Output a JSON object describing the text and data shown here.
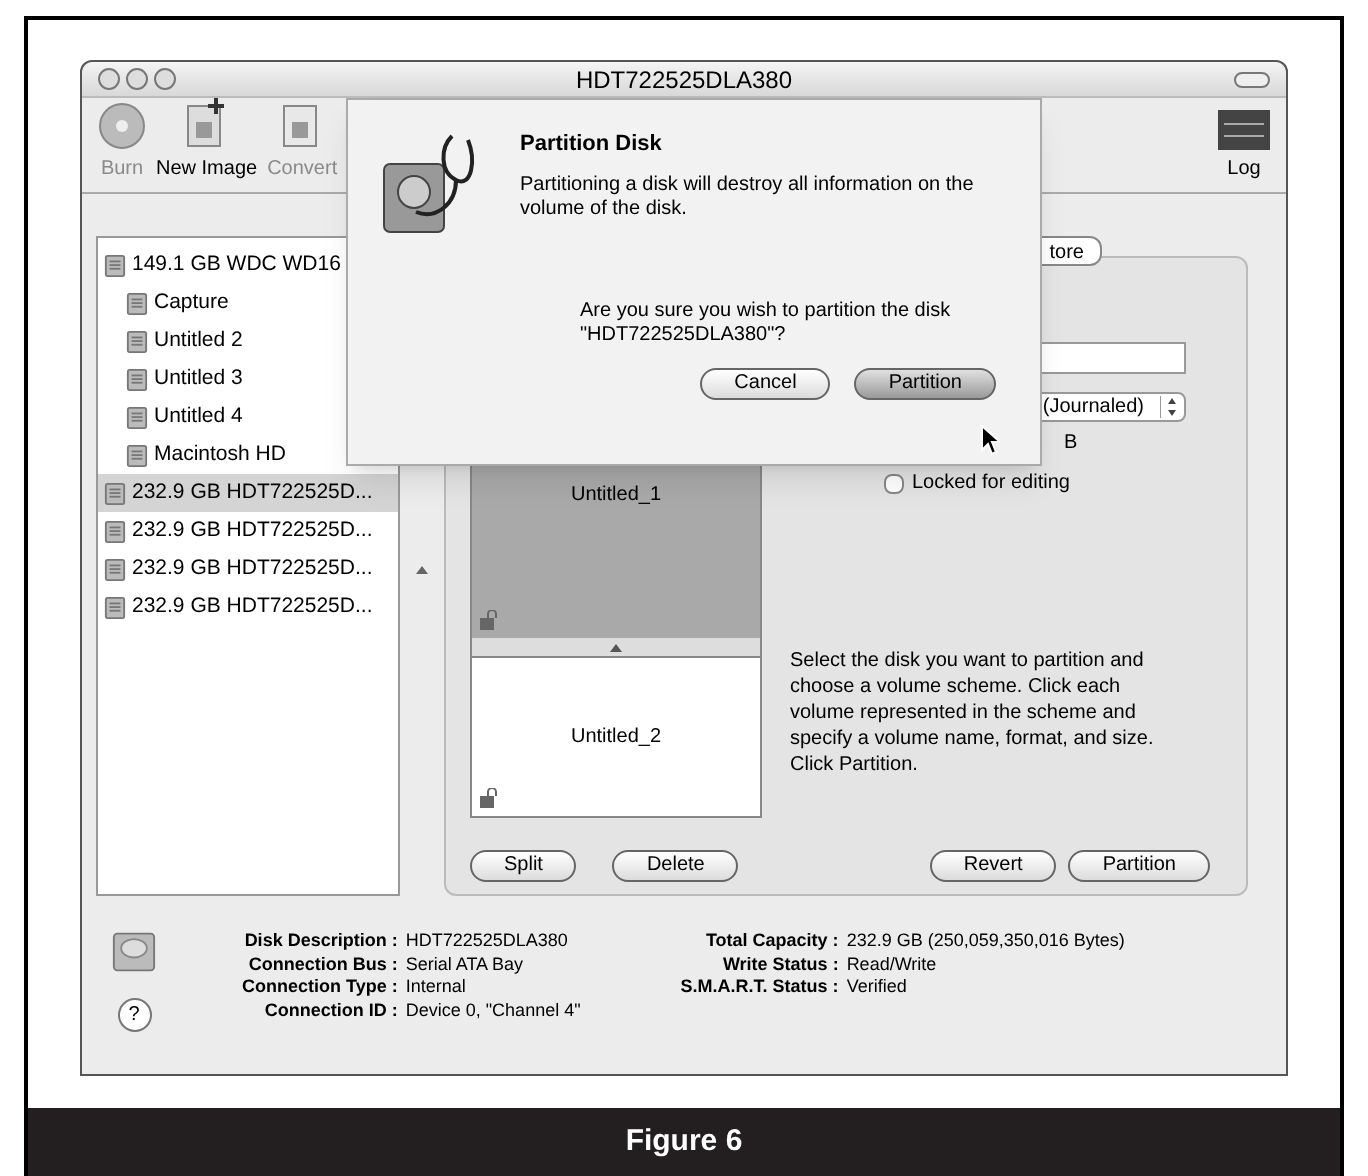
{
  "window": {
    "title": "HDT722525DLA380"
  },
  "toolbar": [
    {
      "label": "Burn",
      "disabled": true
    },
    {
      "label": "New Image",
      "disabled": false
    },
    {
      "label": "Convert",
      "disabled": true
    }
  ],
  "log": {
    "label": "Log"
  },
  "disks": [
    {
      "label": "149.1 GB WDC WD16",
      "selected": false,
      "children": [
        {
          "label": "Capture",
          "selected": false
        },
        {
          "label": "Untitled 2",
          "selected": false
        },
        {
          "label": "Untitled 3",
          "selected": false
        },
        {
          "label": "Untitled 4",
          "selected": false
        },
        {
          "label": "Macintosh HD",
          "selected": false
        }
      ]
    },
    {
      "label": "232.9 GB HDT722525D...",
      "selected": true
    },
    {
      "label": "232.9 GB HDT722525D...",
      "selected": false
    },
    {
      "label": "232.9 GB HDT722525D...",
      "selected": false
    },
    {
      "label": "232.9 GB HDT722525D...",
      "selected": false
    }
  ],
  "tabs": [
    {
      "label": "tore",
      "selected": false
    }
  ],
  "volumes": [
    {
      "name": "Untitled_1",
      "selected": true
    },
    {
      "name": "Untitled_2",
      "selected": false
    }
  ],
  "volume_info": {
    "format_value": "(Journaled)",
    "size_unit": "B",
    "locked": {
      "label": "Locked for editing",
      "checked": false
    }
  },
  "help_text": "Select the disk you want to partition and choose a volume scheme. Click each volume represented in the scheme and specify a volume name, format, and size. Click Partition.",
  "panel_buttons": {
    "left": [
      "Split",
      "Delete"
    ],
    "right": [
      "Revert",
      "Partition"
    ]
  },
  "info": {
    "left": [
      {
        "label": "Disk Description :",
        "value": "HDT722525DLA380"
      },
      {
        "label": "Connection Bus :",
        "value": "Serial ATA Bay"
      },
      {
        "label": "Connection Type :",
        "value": "Internal"
      },
      {
        "label": "Connection ID :",
        "value": "Device 0, \"Channel 4\""
      }
    ],
    "right": [
      {
        "label": "Total Capacity :",
        "value": "232.9 GB (250,059,350,016 Bytes)"
      },
      {
        "label": "Write Status :",
        "value": "Read/Write"
      },
      {
        "label": "S.M.A.R.T. Status :",
        "value": "Verified"
      }
    ]
  },
  "help_button": "?",
  "dialog": {
    "title": "Partition Disk",
    "message": "Partitioning a disk will destroy all information on the volume of the disk.",
    "question": "Are you sure you wish to partition the disk \"HDT722525DLA380\"?",
    "buttons": [
      {
        "label": "Cancel",
        "default": false
      },
      {
        "label": "Partition",
        "default": true
      }
    ]
  },
  "caption": "Figure 6"
}
